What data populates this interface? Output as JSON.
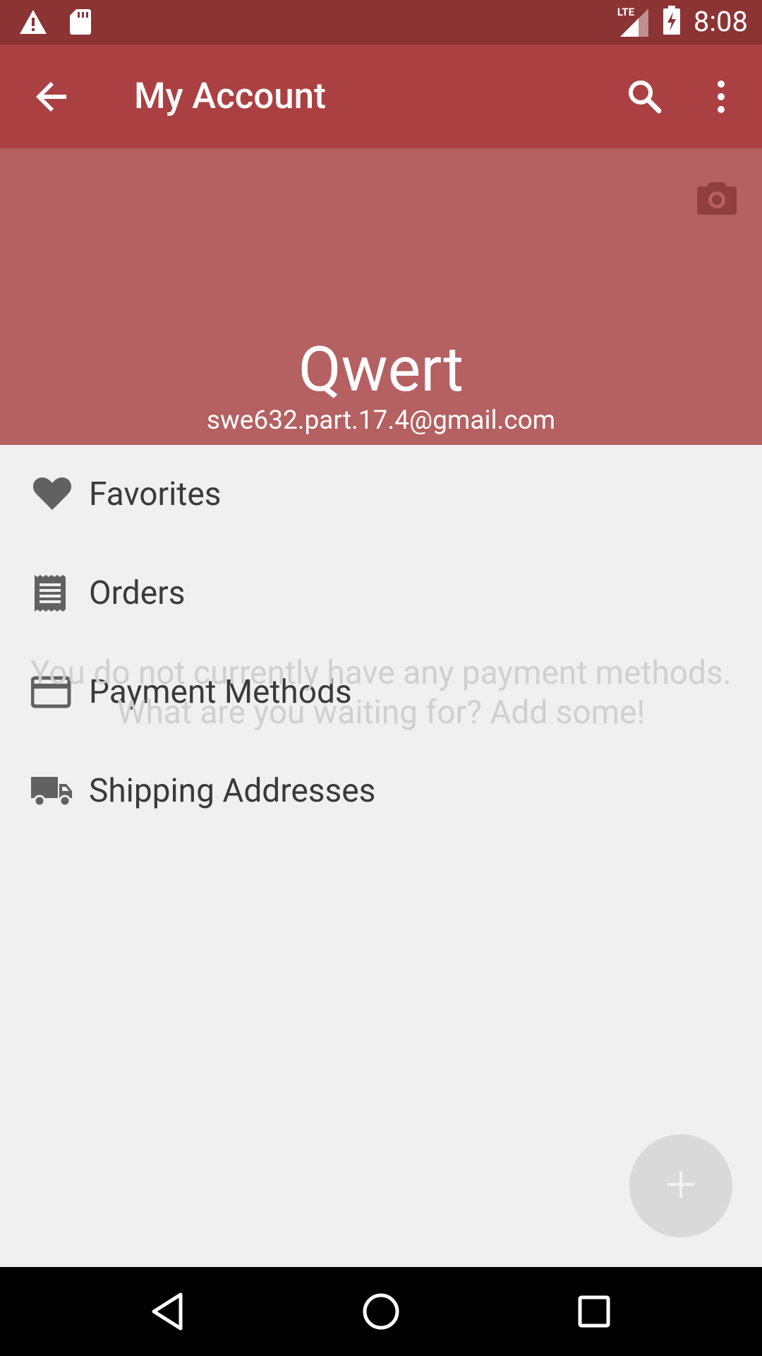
{
  "status_bar": {
    "time": "8:08",
    "network": "LTE",
    "icons": [
      "warning-icon",
      "sd-card-icon",
      "signal-lte-icon",
      "battery-charging-icon"
    ]
  },
  "app_bar": {
    "title": "My Account",
    "icons": [
      "back-arrow-icon",
      "search-icon",
      "more-vert-icon"
    ]
  },
  "profile": {
    "name": "Qwert",
    "email": "swe632.part.17.4@gmail.com"
  },
  "menu": {
    "items": [
      {
        "label": "Favorites",
        "icon": "heart-icon"
      },
      {
        "label": "Orders",
        "icon": "receipt-icon"
      },
      {
        "label": "Payment Methods",
        "icon": "credit-card-icon"
      },
      {
        "label": "Shipping Addresses",
        "icon": "truck-icon"
      }
    ]
  },
  "empty_state": {
    "line1": "You do not currently have any payment methods.",
    "line2": "What are you waiting for? Add some!"
  },
  "fab": {
    "label": "+"
  },
  "colors": {
    "status_bar": "#8c3334",
    "app_bar": "#ab4042",
    "profile_header": "#b56061",
    "background": "#f0f0f0"
  }
}
